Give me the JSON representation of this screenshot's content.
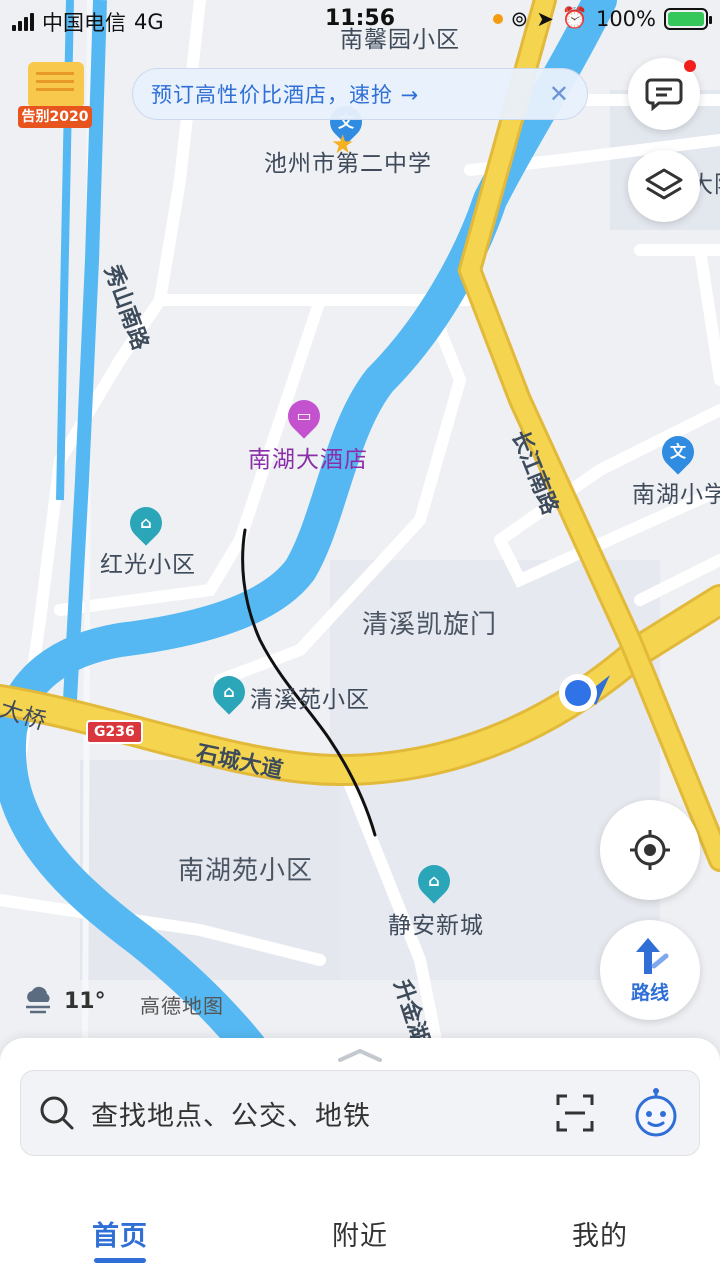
{
  "status_bar": {
    "carrier": "中国电信",
    "network": "4G",
    "time": "11:56",
    "battery": "100%"
  },
  "badge": {
    "label": "告别2020"
  },
  "banner": {
    "text": "预订高性价比酒店，速抢 →",
    "close": "✕"
  },
  "map": {
    "labels": {
      "nanxin": "南馨园小区",
      "school2": "池州市第二中学",
      "hotel": "南湖大酒店",
      "hongguang": "红光小区",
      "qingxi_kaixuan": "清溪凯旋门",
      "qingxiyuan": "清溪苑小区",
      "nanhuyuan": "南湖苑小区",
      "jingan": "静安新城",
      "nanhu_school": "南湖小学",
      "dayang": "大阳",
      "daqiao": "大桥"
    },
    "roads": {
      "xiushan": "秀山南路",
      "changjiang": "长江南路",
      "shicheng": "石城大道",
      "shengjin": "升金湖路",
      "g236": "G236"
    }
  },
  "controls": {
    "route_label": "路线"
  },
  "weather": {
    "temp": "11°"
  },
  "brand": "高德地图",
  "search": {
    "placeholder": "查找地点、公交、地铁"
  },
  "tabs": [
    "首页",
    "附近",
    "我的"
  ],
  "colors": {
    "accent": "#2f6fd6",
    "river": "#55b8f2",
    "road_major": "#f5d54f",
    "road_minor": "#ffffff"
  }
}
